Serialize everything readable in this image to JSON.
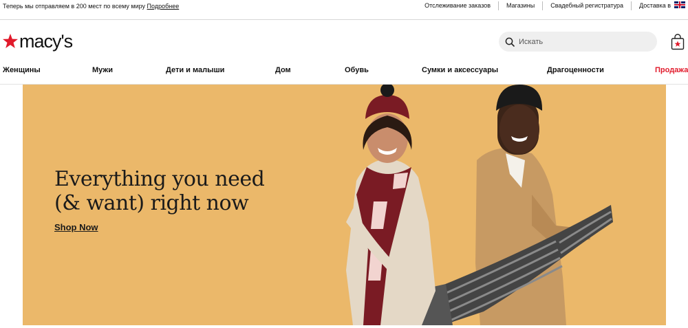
{
  "topbar": {
    "shipping_text": "Теперь мы отправляем в 200 мест по всему миру",
    "shipping_link": "Подробнее",
    "links": [
      "Отслеживание заказов",
      "Магазины",
      "Свадебный регистратура",
      "Доставка в"
    ],
    "flag_icon": "uk-flag-icon"
  },
  "header": {
    "logo_text": "macy's",
    "logo_color": "#e11a2b",
    "search_placeholder": "Искать",
    "bag_icon": "shopping-bag-icon"
  },
  "nav": {
    "items": [
      "Женщины",
      "Мужи",
      "Дети и малыши",
      "Дом",
      "Обувь",
      "Сумки и аксессуары",
      "Драгоценности",
      "Продажа"
    ],
    "sale_color": "#e11a2b"
  },
  "hero": {
    "headline_line1": "Everything you need",
    "headline_line2": "(& want) right now",
    "cta": "Shop Now",
    "background": "#ebb86a"
  }
}
